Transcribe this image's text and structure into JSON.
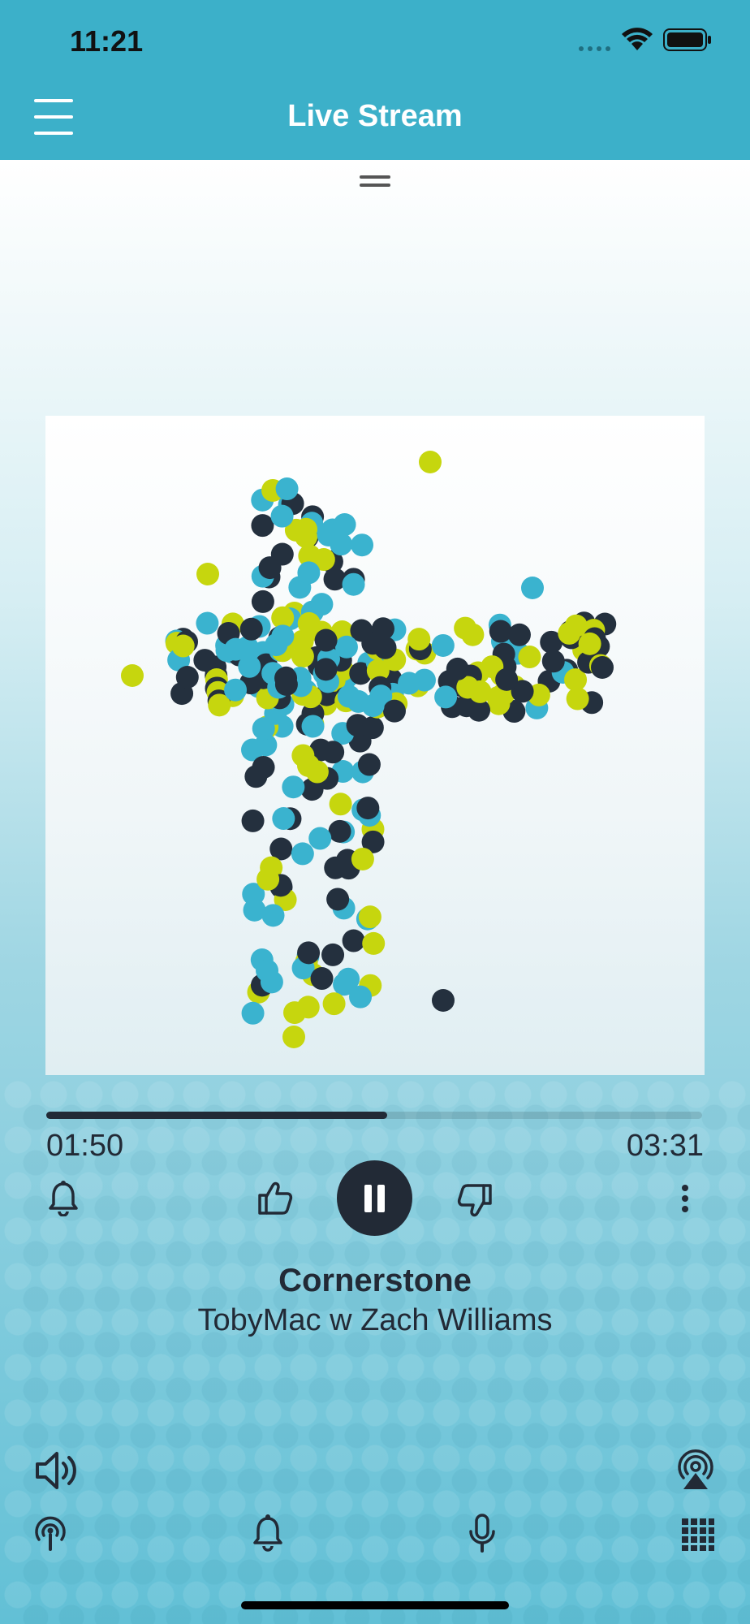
{
  "status_bar": {
    "time": "11:21",
    "icons": [
      "signal-icon",
      "wifi-icon",
      "battery-icon"
    ]
  },
  "header": {
    "title": "Live Stream",
    "menu_icon": "hamburger-menu-icon"
  },
  "player": {
    "progress": 0.52,
    "elapsed": "01:50",
    "total": "03:31",
    "song_title": "Cornerstone",
    "artist": "TobyMac w Zach Williams",
    "controls": [
      "bell-icon",
      "thumbs-up-icon",
      "pause-icon",
      "thumbs-down-icon",
      "more-vertical-icon"
    ]
  },
  "bottom_controls": {
    "row1": [
      "volume-icon",
      "airplay-icon"
    ],
    "row2": [
      "broadcast-icon",
      "bell-icon",
      "microphone-icon",
      "grid-icon"
    ]
  },
  "colors": {
    "header": "#3cb0c9",
    "dark": "#222a36",
    "cyan_dot": "#3ab3cf",
    "lime_dot": "#c6d60e",
    "navy_dot": "#24303e"
  }
}
